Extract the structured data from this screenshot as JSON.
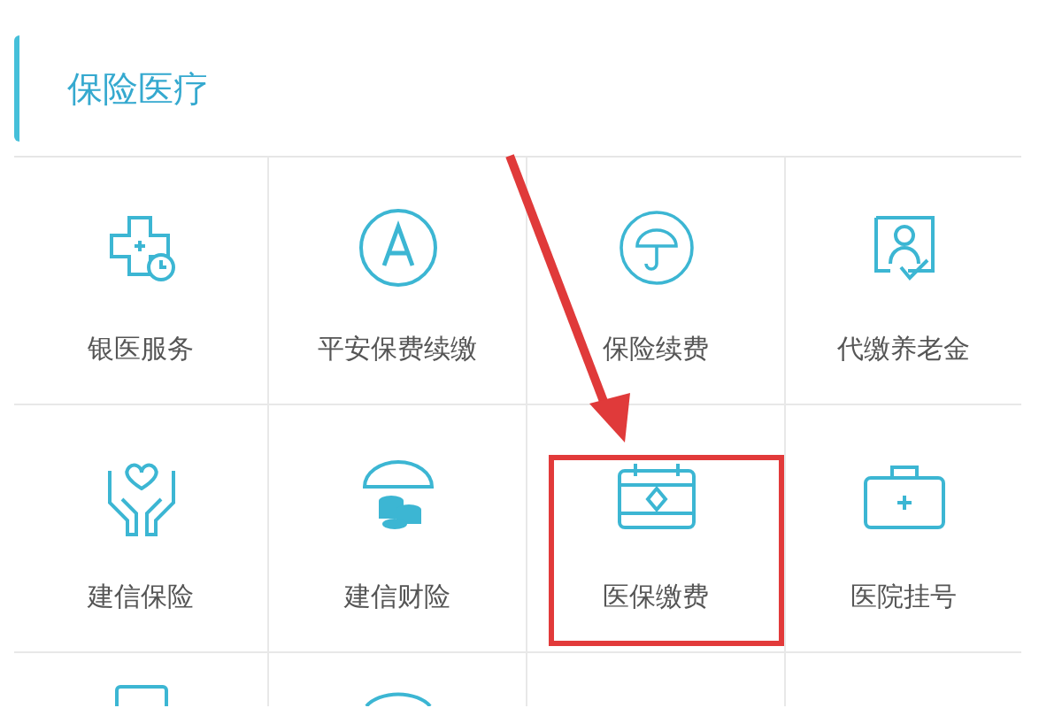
{
  "section": {
    "title": "保险医疗"
  },
  "items": [
    {
      "label": "银医服务",
      "highlighted": false
    },
    {
      "label": "平安保费续缴",
      "highlighted": false
    },
    {
      "label": "保险续费",
      "highlighted": false
    },
    {
      "label": "代缴养老金",
      "highlighted": false
    },
    {
      "label": "建信保险",
      "highlighted": false
    },
    {
      "label": "建信财险",
      "highlighted": false
    },
    {
      "label": "医保缴费",
      "highlighted": true
    },
    {
      "label": "医院挂号",
      "highlighted": false
    }
  ]
}
